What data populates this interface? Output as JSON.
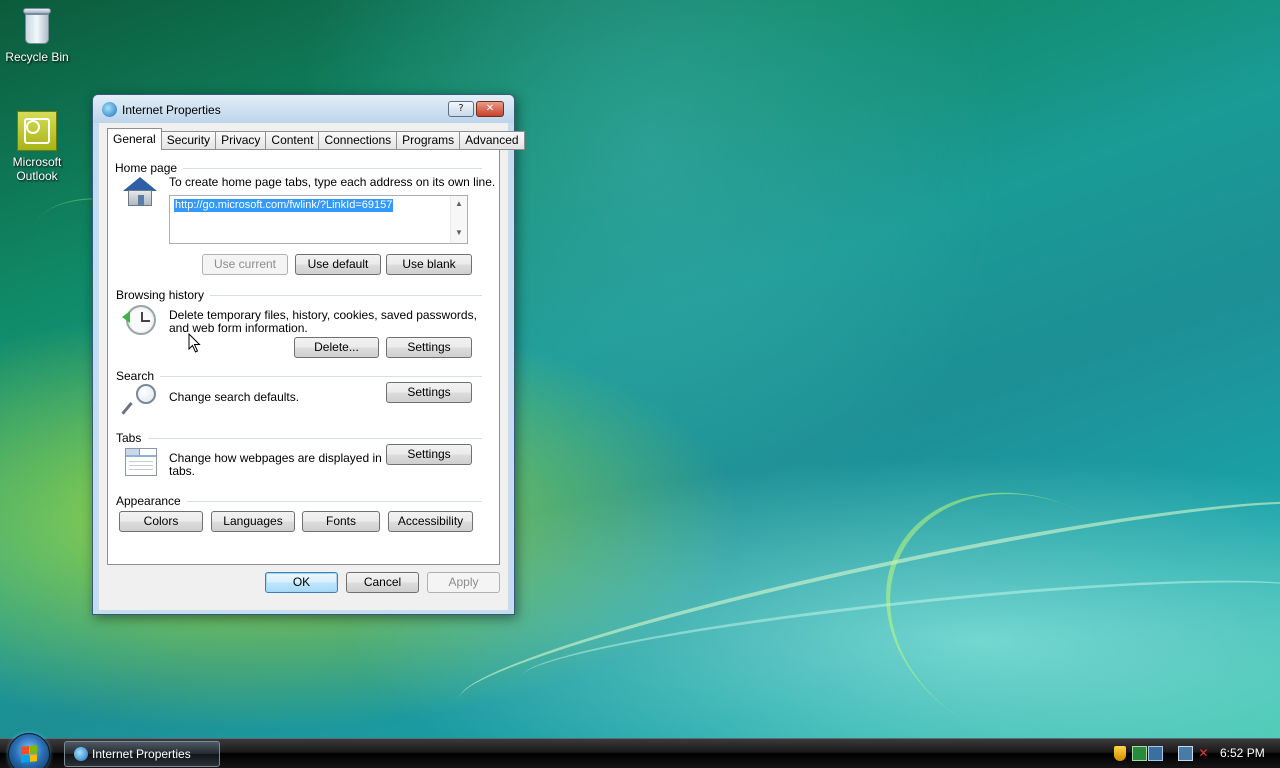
{
  "desktop": {
    "icons": [
      {
        "label": "Recycle Bin"
      },
      {
        "label": "Microsoft Outlook"
      }
    ]
  },
  "dialog": {
    "title": "Internet Properties",
    "help_label": "?",
    "close_label": "✕",
    "tabs": [
      "General",
      "Security",
      "Privacy",
      "Content",
      "Connections",
      "Programs",
      "Advanced"
    ],
    "active_tab": "General",
    "home_page": {
      "heading": "Home page",
      "instruction": "To create home page tabs, type each address on its own line.",
      "url": "http://go.microsoft.com/fwlink/?LinkId=69157",
      "buttons": {
        "use_current": "Use current",
        "use_default": "Use default",
        "use_blank": "Use blank"
      }
    },
    "browsing_history": {
      "heading": "Browsing history",
      "line1": "Delete temporary files, history, cookies, saved passwords,",
      "line2": "and web form information.",
      "buttons": {
        "delete": "Delete...",
        "settings": "Settings"
      }
    },
    "search": {
      "heading": "Search",
      "text": "Change search defaults.",
      "settings": "Settings"
    },
    "tabs_section": {
      "heading": "Tabs",
      "line1": "Change how webpages are displayed in",
      "line2": "tabs.",
      "settings": "Settings"
    },
    "appearance": {
      "heading": "Appearance",
      "buttons": {
        "colors": "Colors",
        "languages": "Languages",
        "fonts": "Fonts",
        "accessibility": "Accessibility"
      }
    },
    "footer": {
      "ok": "OK",
      "cancel": "Cancel",
      "apply": "Apply"
    }
  },
  "taskbar": {
    "task_item": "Internet Properties",
    "clock": "6:52 PM"
  },
  "colors": {
    "selection": "#3399ff",
    "dialog_frame": "#c6dcef",
    "close_red": "#c4422d"
  }
}
